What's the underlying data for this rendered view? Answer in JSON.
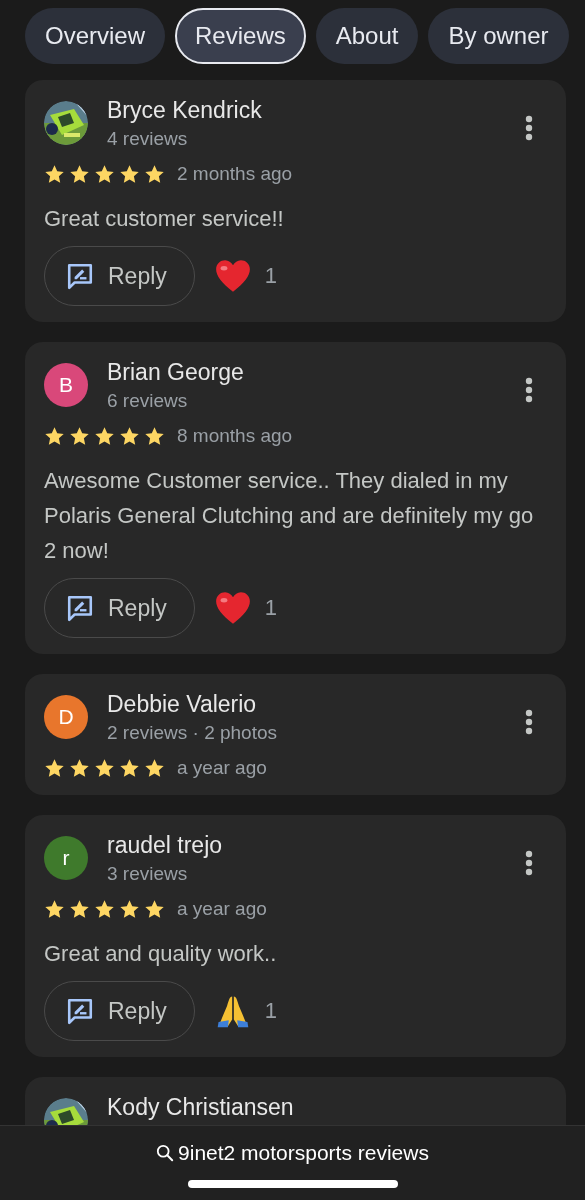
{
  "tabs": [
    {
      "label": "Overview",
      "selected": false
    },
    {
      "label": "Reviews",
      "selected": true
    },
    {
      "label": "About",
      "selected": false
    },
    {
      "label": "By owner",
      "selected": false
    }
  ],
  "reviews": [
    {
      "name": "Bryce Kendrick",
      "meta": "4 reviews",
      "stars": 5,
      "time": "2 months ago",
      "text": "Great customer service!!",
      "reply": "Reply",
      "reaction": {
        "kind": "heart",
        "count": "1"
      }
    },
    {
      "avatar": {
        "kind": "letter",
        "letter": "B",
        "color": "#d9487a"
      },
      "name": "Brian George",
      "meta": "6 reviews",
      "stars": 5,
      "time": "8 months ago",
      "text": "Awesome Customer service.. They dialed in my Polaris General Clutching and are definitely my go 2 now!",
      "reply": "Reply",
      "reaction": {
        "kind": "heart",
        "count": "1"
      }
    },
    {
      "avatar": {
        "kind": "letter",
        "letter": "D",
        "color": "#e8762c"
      },
      "name": "Debbie Valerio",
      "meta": "2 reviews · 2 photos",
      "stars": 5,
      "time": "a year ago"
    },
    {
      "avatar": {
        "kind": "letter",
        "letter": "r",
        "color": "#3f7a2c"
      },
      "name": "raudel trejo",
      "meta": "3 reviews",
      "stars": 5,
      "time": "a year ago",
      "text": "Great and quality work..",
      "reply": "Reply",
      "reaction": {
        "kind": "pray",
        "count": "1"
      }
    },
    {
      "name": "Kody Christiansen"
    }
  ],
  "search": {
    "text": "9inet2 motorsports reviews"
  }
}
